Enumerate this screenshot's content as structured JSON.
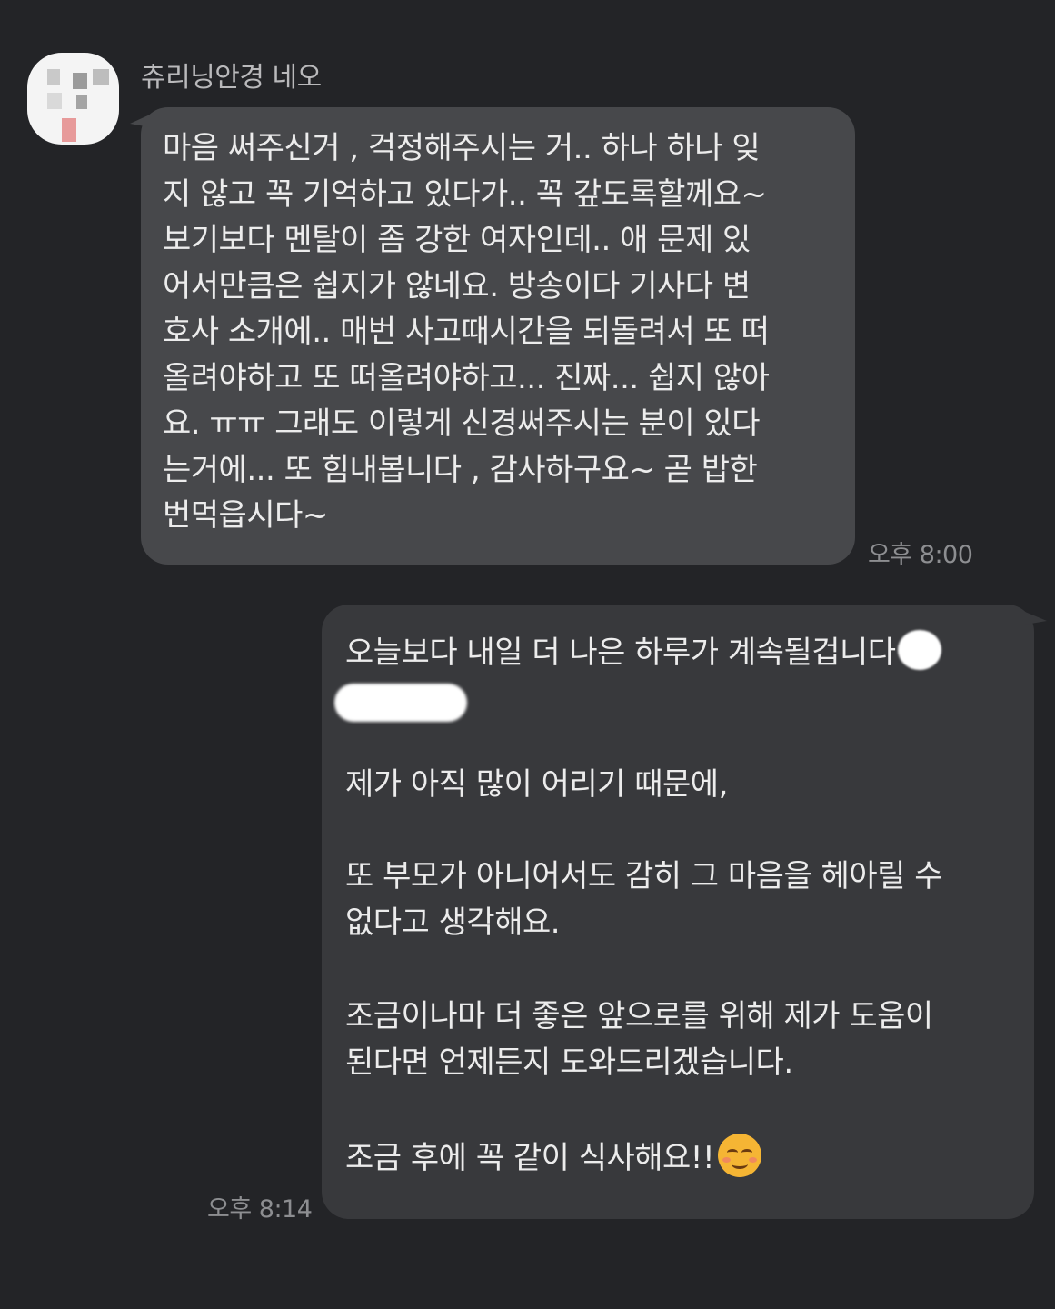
{
  "incoming": {
    "sender_name": "츄리닝안경 네오",
    "lines": [
      "마음 써주신거 , 걱정해주시는 거.. 하나 하나 잊",
      "지 않고 꼭 기억하고 있다가.. 꼭 갚도록할께요~",
      "보기보다 멘탈이 좀 강한 여자인데.. 애 문제 있",
      "어서만큼은 쉽지가 않네요. 방송이다 기사다 변",
      "호사 소개에.. 매번 사고때시간을 되돌려서 또 떠",
      "올려야하고 또 떠올려야하고... 진짜... 쉽지 않아",
      "요. ㅠㅠ 그래도 이렇게 신경써주시는 분이 있다",
      "는거에... 또 힘내봅니다 , 감사하구요~ 곧 밥한",
      "번먹읍시다~"
    ],
    "time": "오후 8:00"
  },
  "outgoing": {
    "line1": "오늘보다 내일 더 나은 하루가 계속될겁니다",
    "line2": "제가 아직 많이 어리기 때문에,",
    "line3": "또 부모가 아니어서도 감히 그 마음을 헤아릴 수",
    "line4": "없다고 생각해요.",
    "line5": "조금이나마 더 좋은 앞으로를 위해 제가 도움이",
    "line6": "된다면 언제든지 도와드리겠습니다.",
    "line7": "조금 후에 꼭 같이 식사해요!!",
    "emoji": "relieved-smiling-face-emoji",
    "time": "오후 8:14"
  },
  "colors": {
    "background": "#232427",
    "incoming_bubble": "#47484b",
    "outgoing_bubble": "#38393c",
    "timestamp": "#8d8e91"
  }
}
